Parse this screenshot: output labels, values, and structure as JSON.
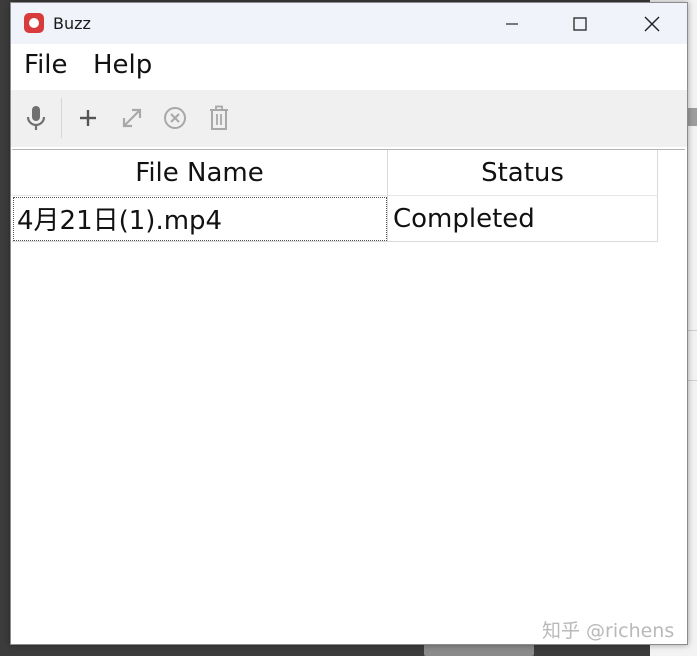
{
  "window": {
    "title": "Buzz",
    "controls": {
      "minimize": "—",
      "maximize": "☐",
      "close": "✕"
    }
  },
  "menu": {
    "file": "File",
    "help": "Help"
  },
  "toolbar": {
    "buttons": [
      {
        "icon": "microphone-icon"
      },
      {
        "icon": "plus-icon"
      },
      {
        "icon": "expand-icon"
      },
      {
        "icon": "cancel-icon"
      },
      {
        "icon": "trash-icon"
      }
    ]
  },
  "table": {
    "columns": [
      "File Name",
      "Status"
    ],
    "rows": [
      {
        "file_name": "4月21日(1).mp4",
        "status": "Completed"
      }
    ]
  },
  "watermark": "知乎 @richens",
  "colors": {
    "app_icon": "#d83b3b",
    "titlebar": "#f0f4fa",
    "toolbar": "#f0f0f0"
  }
}
